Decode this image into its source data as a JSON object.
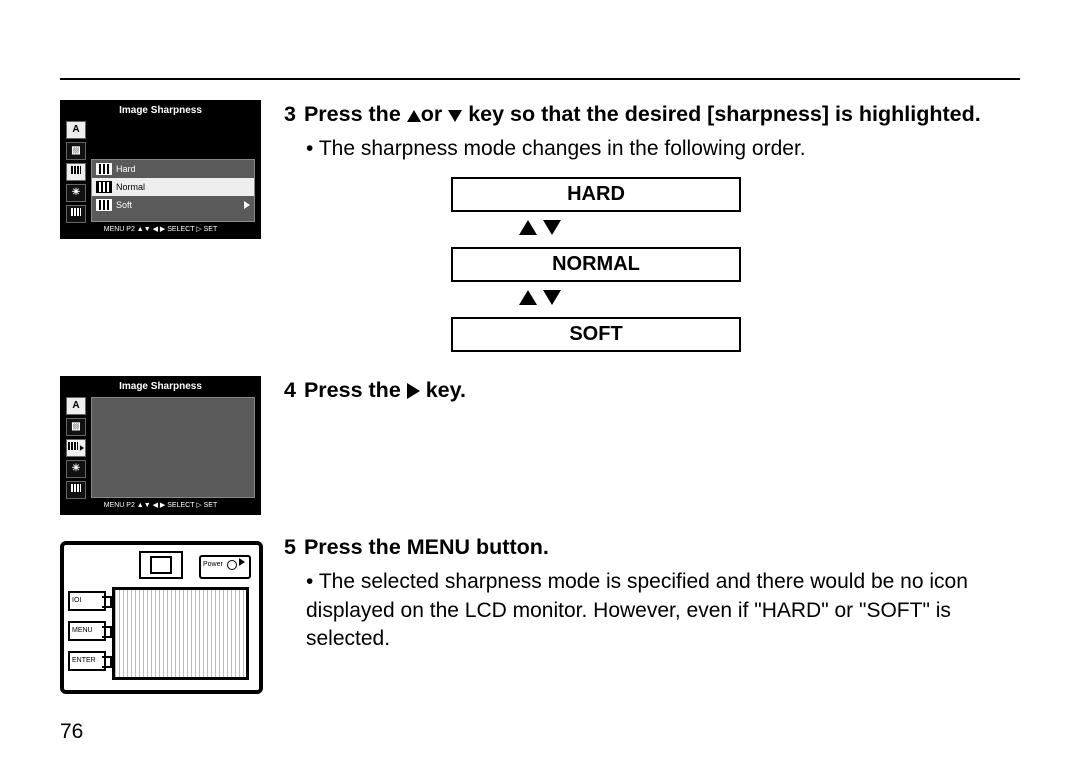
{
  "page_number": "76",
  "lcd1": {
    "title": "Image Sharpness",
    "side_letter": "A",
    "rows": [
      {
        "label": "Hard"
      },
      {
        "label": "Normal",
        "selected": true
      },
      {
        "label": "Soft"
      }
    ],
    "footer": "MENU P2    ▲▼  ◀ ▶  SELECT      ▷ SET"
  },
  "lcd2": {
    "title": "Image Sharpness",
    "side_letter": "A",
    "footer": "MENU P2    ▲▼  ◀ ▶  SELECT      ▷ SET"
  },
  "cam": {
    "power": "Power",
    "buttons": [
      "IOI",
      "MENU",
      "ENTER"
    ]
  },
  "steps": {
    "s3": {
      "num": "3",
      "head_a": "Press the ",
      "head_b": "or ",
      "head_c": " key so that the desired [sharpness] is highlighted.",
      "line1": "The sharpness mode changes in the following order."
    },
    "options": [
      "HARD",
      "NORMAL",
      "SOFT"
    ],
    "s4": {
      "num": "4",
      "head_a": "Press the ",
      "head_b": " key."
    },
    "s5": {
      "num": "5",
      "head": "Press the MENU button.",
      "line1": "The selected sharpness mode is specified and there would be no icon displayed on the LCD monitor. However, even if  \"HARD\" or \"SOFT\" is selected."
    }
  }
}
